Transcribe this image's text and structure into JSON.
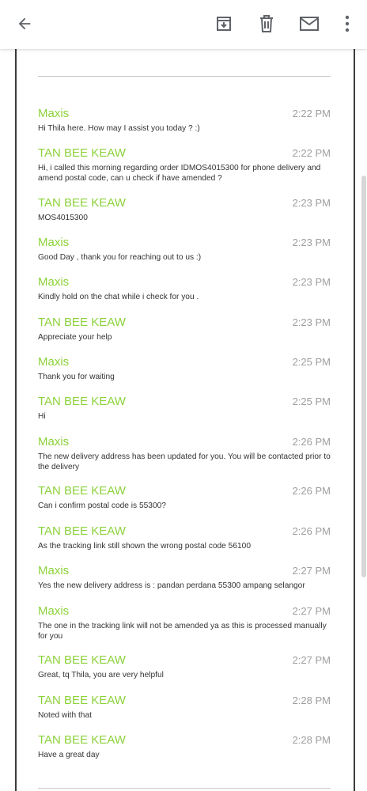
{
  "toolbar": {
    "back_icon": "arrow-left-icon",
    "archive_icon": "archive-icon",
    "delete_icon": "trash-icon",
    "mark_unread_icon": "mail-icon",
    "more_icon": "more-vertical-icon"
  },
  "colors": {
    "sender": "#8cd23a",
    "time": "#9e9e9e",
    "body": "#333333",
    "frame": "#3c3c3c"
  },
  "messages": [
    {
      "sender": "Maxis",
      "time": "2:22 PM",
      "text": "Hi Thila here. How may I assist you today ? :)"
    },
    {
      "sender": "TAN BEE KEAW",
      "time": "2:22 PM",
      "text": "Hi, i called this morning regarding order IDMOS4015300 for phone delivery and amend postal code, can u check if have amended ?"
    },
    {
      "sender": "TAN BEE KEAW",
      "time": "2:23 PM",
      "text": "MOS4015300"
    },
    {
      "sender": "Maxis",
      "time": "2:23 PM",
      "text": "Good Day , thank you for reaching out to us :)"
    },
    {
      "sender": "Maxis",
      "time": "2:23 PM",
      "text": "Kindly hold on the chat while i check for you ."
    },
    {
      "sender": "TAN BEE KEAW",
      "time": "2:23 PM",
      "text": "Appreciate your help"
    },
    {
      "sender": "Maxis",
      "time": "2:25 PM",
      "text": "Thank you for waiting"
    },
    {
      "sender": "TAN BEE KEAW",
      "time": "2:25 PM",
      "text": "Hi"
    },
    {
      "sender": "Maxis",
      "time": "2:26 PM",
      "text": "The new delivery address has been updated for you. You will be contacted prior to the delivery"
    },
    {
      "sender": "TAN BEE KEAW",
      "time": "2:26 PM",
      "text": "Can i confirm postal code is 55300?"
    },
    {
      "sender": "TAN BEE KEAW",
      "time": "2:26 PM",
      "text": "As the tracking link still shown the wrong postal code 56100"
    },
    {
      "sender": "Maxis",
      "time": "2:27 PM",
      "text": "Yes the new delivery address is : pandan perdana 55300 ampang selangor"
    },
    {
      "sender": "Maxis",
      "time": "2:27 PM",
      "text": "The one in the tracking link will not be amended ya as this is processed manually for you"
    },
    {
      "sender": "TAN BEE KEAW",
      "time": "2:27 PM",
      "text": "Great, tq Thila, you are very helpful"
    },
    {
      "sender": "TAN BEE KEAW",
      "time": "2:28 PM",
      "text": "Noted with that"
    },
    {
      "sender": "TAN BEE KEAW",
      "time": "2:28 PM",
      "text": "Have a great day"
    }
  ]
}
